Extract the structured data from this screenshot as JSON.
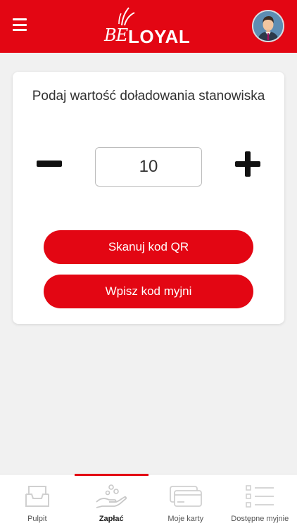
{
  "header": {
    "brand_script": "BE",
    "brand_bold": "LOYAL"
  },
  "card": {
    "title": "Podaj wartość doładowania stanowiska",
    "amount_value": "10",
    "scan_qr_label": "Skanuj kod QR",
    "enter_code_label": "Wpisz kod myjni"
  },
  "nav": {
    "items": [
      {
        "label": "Pulpit",
        "icon": "inbox-tray-icon"
      },
      {
        "label": "Zapłać",
        "icon": "hand-coins-icon"
      },
      {
        "label": "Moje karty",
        "icon": "cards-icon"
      },
      {
        "label": "Dostępne myjnie",
        "icon": "list-icon"
      }
    ],
    "active": "Zapłać"
  },
  "colors": {
    "brand_red": "#e30613",
    "background": "#f1f1f1"
  }
}
